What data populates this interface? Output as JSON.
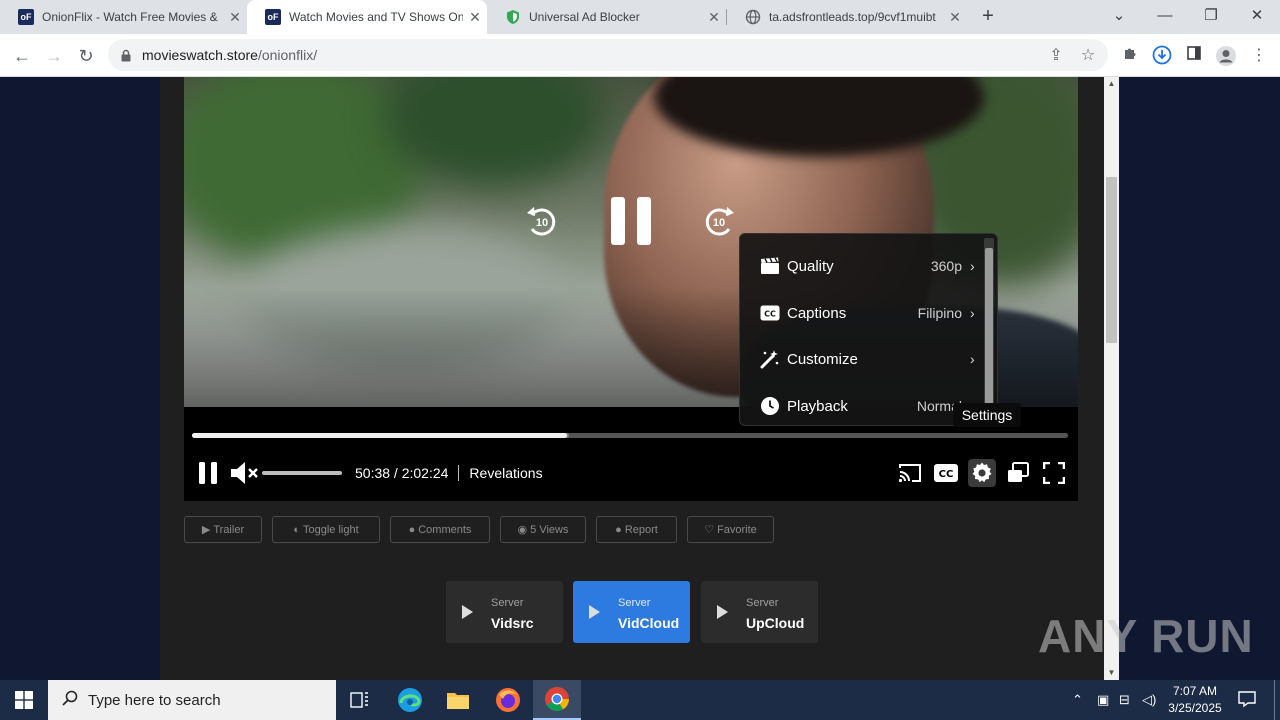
{
  "browser": {
    "tabs": [
      {
        "title": "OnionFlix - Watch Free Movies &",
        "favicon": "oF"
      },
      {
        "title": "Watch Movies and TV Shows On",
        "favicon": "oF"
      },
      {
        "title": "Universal Ad Blocker",
        "favicon": "shield-icon"
      },
      {
        "title": "ta.adsfrontleads.top/9cvf1muibt",
        "favicon": "globe-icon"
      }
    ],
    "active_tab_index": 1,
    "url": {
      "domain": "movieswatch.store",
      "path": "/onionflix/"
    }
  },
  "player": {
    "seek_back_label": "10",
    "seek_forward_label": "10",
    "current_time": "50:38",
    "duration": "2:02:24",
    "time_display": "50:38 / 2:02:24",
    "chapter": "Revelations",
    "progress_fraction": 0.428,
    "buffered_fraction": 0.43,
    "muted": true,
    "settings_tooltip": "Settings",
    "settings_menu": [
      {
        "label": "Quality",
        "value": "360p",
        "icon": "clapperboard-icon"
      },
      {
        "label": "Captions",
        "value": "Filipino",
        "icon": "cc-icon"
      },
      {
        "label": "Customize",
        "value": "",
        "icon": "magic-wand-icon"
      },
      {
        "label": "Playback",
        "value": "Normal",
        "icon": "clock-icon"
      }
    ]
  },
  "actions": [
    {
      "label": "Trailer",
      "icon": "youtube-icon"
    },
    {
      "label": "Toggle light",
      "icon": "lightbulb-icon"
    },
    {
      "label": "Comments",
      "icon": "comment-icon"
    },
    {
      "label": "5 Views",
      "icon": "eye-icon"
    },
    {
      "label": "Report",
      "icon": "warning-icon"
    },
    {
      "label": "Favorite",
      "icon": "heart-icon"
    }
  ],
  "servers": [
    {
      "caption": "Server",
      "name": "Vidsrc",
      "active": false
    },
    {
      "caption": "Server",
      "name": "VidCloud",
      "active": true
    },
    {
      "caption": "Server",
      "name": "UpCloud",
      "active": false
    }
  ],
  "watermark": "ANY RUN",
  "taskbar": {
    "search_placeholder": "Type here to search",
    "time": "7:07 AM",
    "date": "3/25/2025"
  },
  "colors": {
    "page_bg": "#0f1830",
    "content_bg": "#1f1f1f",
    "active_server": "#2d7be0",
    "taskbar": "#1c2b46"
  }
}
